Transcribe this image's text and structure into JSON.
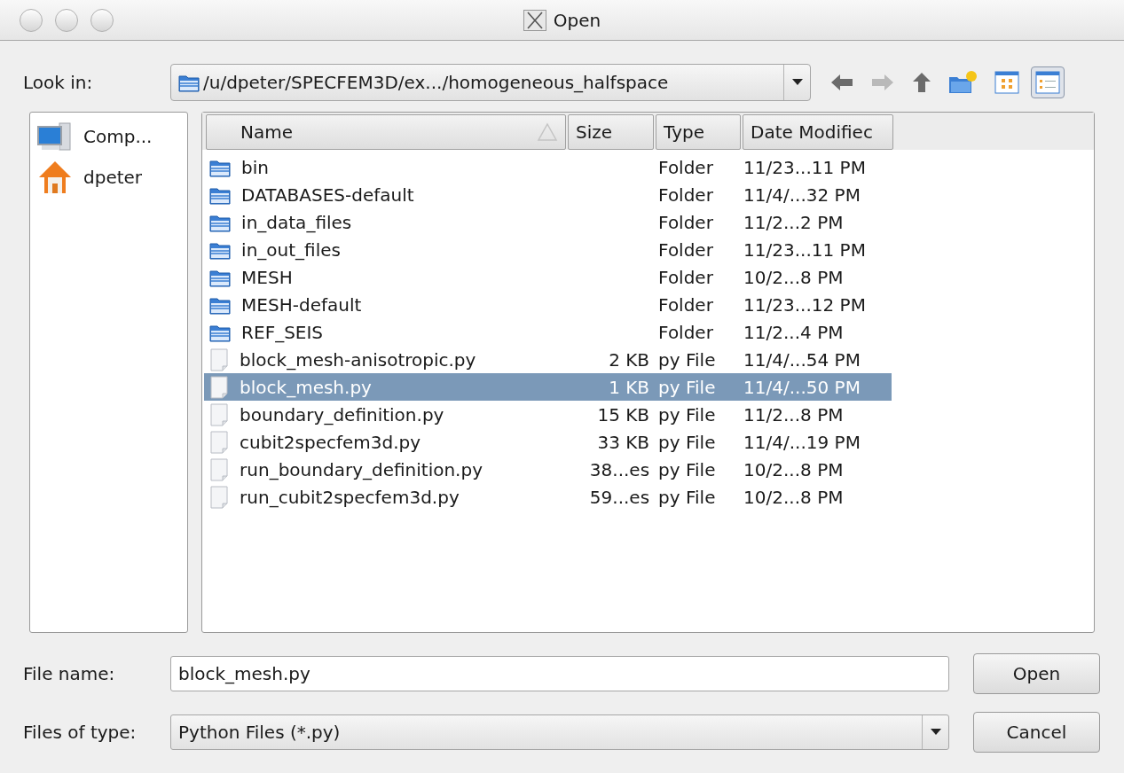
{
  "window": {
    "title": "Open"
  },
  "look_in": {
    "label": "Look in:",
    "path": "/u/dpeter/SPECFEM3D/ex.../homogeneous_halfspace"
  },
  "toolbar": [
    {
      "kind": "back",
      "disabled": false,
      "selected": false
    },
    {
      "kind": "forward",
      "disabled": true,
      "selected": false
    },
    {
      "kind": "up",
      "disabled": false,
      "selected": false
    },
    {
      "kind": "new-folder",
      "disabled": false,
      "selected": false
    },
    {
      "kind": "list-view",
      "disabled": false,
      "selected": false
    },
    {
      "kind": "detail-view",
      "disabled": false,
      "selected": true
    }
  ],
  "sidebar": {
    "items": [
      {
        "kind": "computer",
        "label": "Comp..."
      },
      {
        "kind": "home",
        "label": "dpeter"
      }
    ]
  },
  "table": {
    "columns": [
      {
        "label": "Name",
        "sorted": true
      },
      {
        "label": "Size",
        "sorted": false
      },
      {
        "label": "Type",
        "sorted": false
      },
      {
        "label": "Date Modifiec",
        "sorted": false
      }
    ],
    "rows": [
      {
        "kind": "folder",
        "name": "bin",
        "size": "",
        "type": "Folder",
        "date": "11/23...11 PM",
        "selected": false
      },
      {
        "kind": "folder",
        "name": "DATABASES-default",
        "size": "",
        "type": "Folder",
        "date": "11/4/...32 PM",
        "selected": false
      },
      {
        "kind": "folder",
        "name": "in_data_files",
        "size": "",
        "type": "Folder",
        "date": "11/2...2 PM",
        "selected": false
      },
      {
        "kind": "folder",
        "name": "in_out_files",
        "size": "",
        "type": "Folder",
        "date": "11/23...11 PM",
        "selected": false
      },
      {
        "kind": "folder",
        "name": "MESH",
        "size": "",
        "type": "Folder",
        "date": "10/2...8 PM",
        "selected": false
      },
      {
        "kind": "folder",
        "name": "MESH-default",
        "size": "",
        "type": "Folder",
        "date": "11/23...12 PM",
        "selected": false
      },
      {
        "kind": "folder",
        "name": "REF_SEIS",
        "size": "",
        "type": "Folder",
        "date": "11/2...4 PM",
        "selected": false
      },
      {
        "kind": "file",
        "name": "block_mesh-anisotropic.py",
        "size": "2 KB",
        "type": "py File",
        "date": "11/4/...54 PM",
        "selected": false
      },
      {
        "kind": "file",
        "name": "block_mesh.py",
        "size": "1 KB",
        "type": "py File",
        "date": "11/4/...50 PM",
        "selected": true
      },
      {
        "kind": "file",
        "name": "boundary_definition.py",
        "size": "15 KB",
        "type": "py File",
        "date": "11/2...8 PM",
        "selected": false
      },
      {
        "kind": "file",
        "name": "cubit2specfem3d.py",
        "size": "33 KB",
        "type": "py File",
        "date": "11/4/...19 PM",
        "selected": false
      },
      {
        "kind": "file",
        "name": "run_boundary_definition.py",
        "size": "38...es",
        "type": "py File",
        "date": "10/2...8 PM",
        "selected": false
      },
      {
        "kind": "file",
        "name": "run_cubit2specfem3d.py",
        "size": "59...es",
        "type": "py File",
        "date": "10/2...8 PM",
        "selected": false
      }
    ]
  },
  "file_name": {
    "label": "File name:",
    "value": "block_mesh.py"
  },
  "file_type": {
    "label": "Files of type:",
    "value": "Python Files (*.py)"
  },
  "buttons": [
    {
      "label": "Open"
    },
    {
      "label": "Cancel"
    }
  ]
}
